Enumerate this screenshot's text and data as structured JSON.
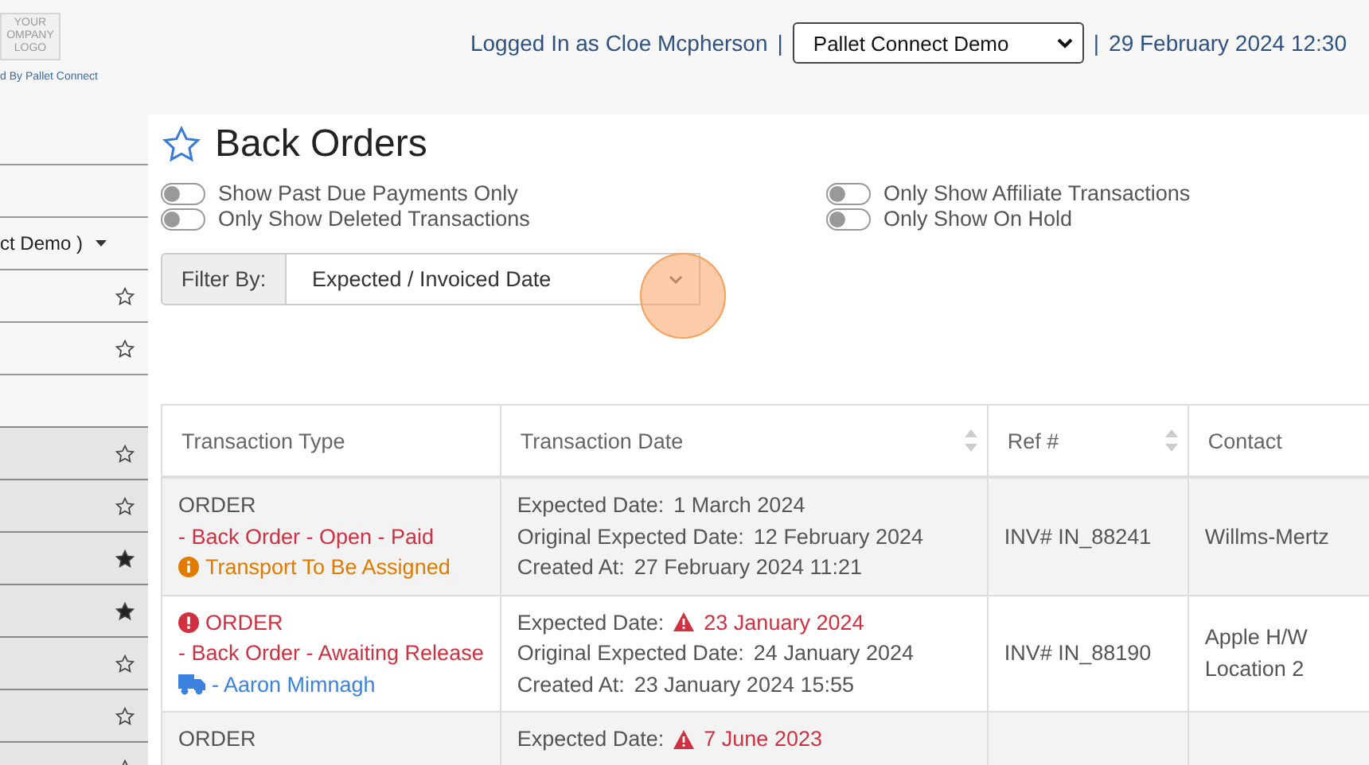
{
  "logo": {
    "lines": [
      "YOUR",
      "OMPANY",
      "LOGO"
    ],
    "caption": "d By Pallet Connect"
  },
  "header": {
    "logged_in": "Logged In as Cloe Mcpherson",
    "separator_left": "|",
    "company_select": "Pallet Connect Demo",
    "separator_right": "|",
    "datetime": "29 February 2024 12:30"
  },
  "sidebar": {
    "items": [
      {
        "kind": "blank"
      },
      {
        "kind": "dropdown",
        "label": "ct Demo )"
      },
      {
        "kind": "star",
        "starred": false
      },
      {
        "kind": "star",
        "starred": false
      },
      {
        "kind": "blank"
      },
      {
        "kind": "star",
        "starred": false
      },
      {
        "kind": "star",
        "starred": false
      },
      {
        "kind": "star",
        "starred": true
      },
      {
        "kind": "star",
        "starred": true
      },
      {
        "kind": "star",
        "starred": false
      },
      {
        "kind": "star",
        "starred": false
      },
      {
        "kind": "star",
        "starred": false
      }
    ]
  },
  "page": {
    "title": "Back Orders",
    "favorite": false
  },
  "toggles": [
    {
      "label": "Show Past Due Payments Only",
      "on": false
    },
    {
      "label": "Only Show Affiliate Transactions",
      "on": false
    },
    {
      "label": "Only Show Deleted Transactions",
      "on": false
    },
    {
      "label": "Only Show On Hold",
      "on": false
    }
  ],
  "filter": {
    "label": "Filter By:",
    "value": "Expected / Invoiced Date"
  },
  "table": {
    "columns": [
      {
        "label": "Transaction Type",
        "sortable": false
      },
      {
        "label": "Transaction Date",
        "sortable": true
      },
      {
        "label": "Ref #",
        "sortable": true
      },
      {
        "label": "Contact"
      }
    ],
    "rows": [
      {
        "type_lines": [
          {
            "kind": "plain",
            "text": "ORDER"
          },
          {
            "kind": "danger",
            "text": "- Back Order - Open - Paid"
          },
          {
            "kind": "warning",
            "text": "Transport To Be Assigned"
          }
        ],
        "dates": [
          {
            "label": "Expected Date:",
            "value": "1 March 2024",
            "overdue": false
          },
          {
            "label": "Original Expected Date:",
            "value": "12 February 2024",
            "overdue": false
          },
          {
            "label": "Created At:",
            "value": "27 February 2024 11:21",
            "overdue": false
          }
        ],
        "ref": "INV# IN_88241",
        "contact": [
          "Willms-Mertz"
        ]
      },
      {
        "type_lines": [
          {
            "kind": "alert",
            "text": "ORDER"
          },
          {
            "kind": "danger",
            "text": "- Back Order - Awaiting Release"
          },
          {
            "kind": "transport",
            "text": "- Aaron Mimnagh"
          }
        ],
        "dates": [
          {
            "label": "Expected Date:",
            "value": "23 January 2024",
            "overdue": true
          },
          {
            "label": "Original Expected Date:",
            "value": "24 January 2024",
            "overdue": false
          },
          {
            "label": "Created At:",
            "value": "23 January 2024 15:55",
            "overdue": false
          }
        ],
        "ref": "INV# IN_88190",
        "contact": [
          "Apple H/W",
          "Location 2"
        ]
      },
      {
        "type_lines": [
          {
            "kind": "plain",
            "text": "ORDER"
          }
        ],
        "dates": [
          {
            "label": "Expected Date:",
            "value": "7 June 2023",
            "overdue": true
          }
        ]
      }
    ]
  }
}
